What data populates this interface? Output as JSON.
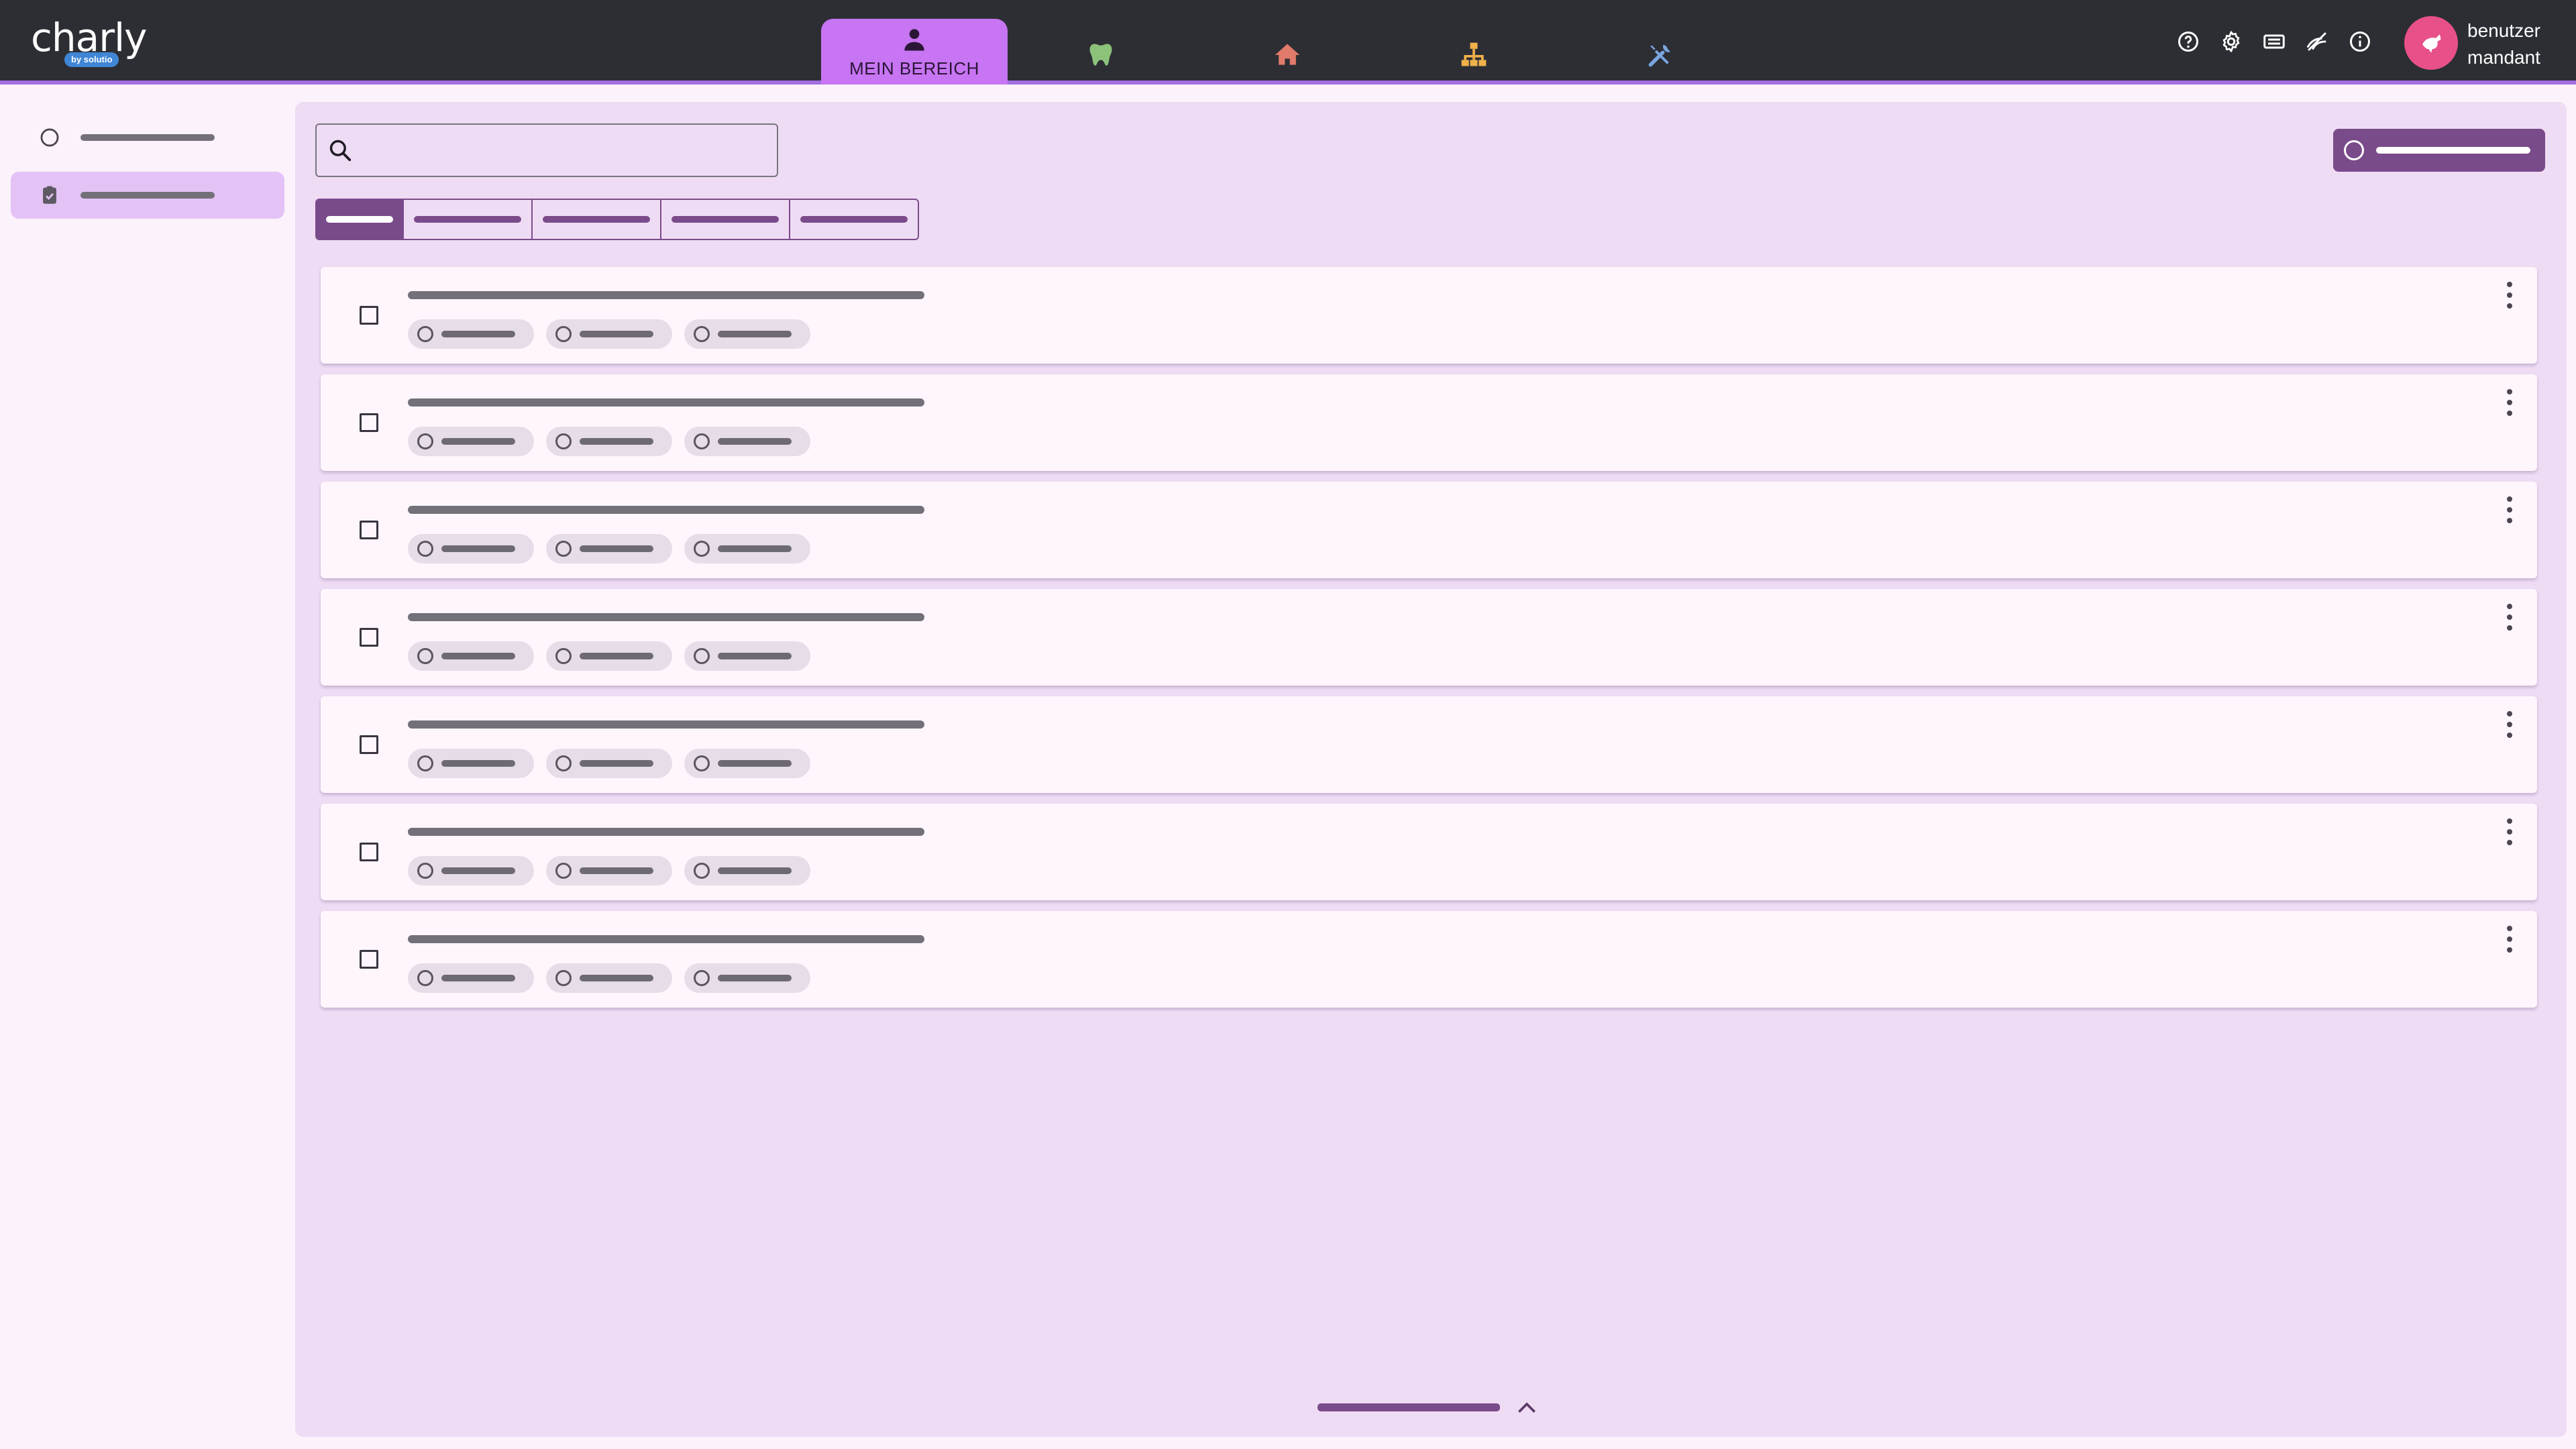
{
  "brand": {
    "name": "charly",
    "sub": "by solutio"
  },
  "nav": {
    "tabs": [
      {
        "id": "mein-bereich",
        "label": "MEIN BEREICH",
        "icon": "person-icon",
        "active": true
      },
      {
        "id": "patient",
        "label": "",
        "icon": "tooth-icon",
        "color": "#8dc27a"
      },
      {
        "id": "praxis",
        "label": "",
        "icon": "home-icon",
        "color": "#e07a6a"
      },
      {
        "id": "organisation",
        "label": "",
        "icon": "org-chart-icon",
        "color": "#f0b04a"
      },
      {
        "id": "werkzeuge",
        "label": "",
        "icon": "tools-icon",
        "color": "#7aa6e0"
      }
    ]
  },
  "utilities": [
    "help-icon",
    "settings-icon",
    "ticket-icon",
    "visibility-off-icon",
    "info-icon"
  ],
  "user": {
    "line1": "benutzer",
    "line2": "mandant",
    "avatar_color": "#e8508a"
  },
  "colors": {
    "accent": "#7a4b8a",
    "topbar": "#2c2e34",
    "active_tab": "#c775f2",
    "panel": "#eedcf5"
  },
  "search": {
    "placeholder": "",
    "value": ""
  }
}
